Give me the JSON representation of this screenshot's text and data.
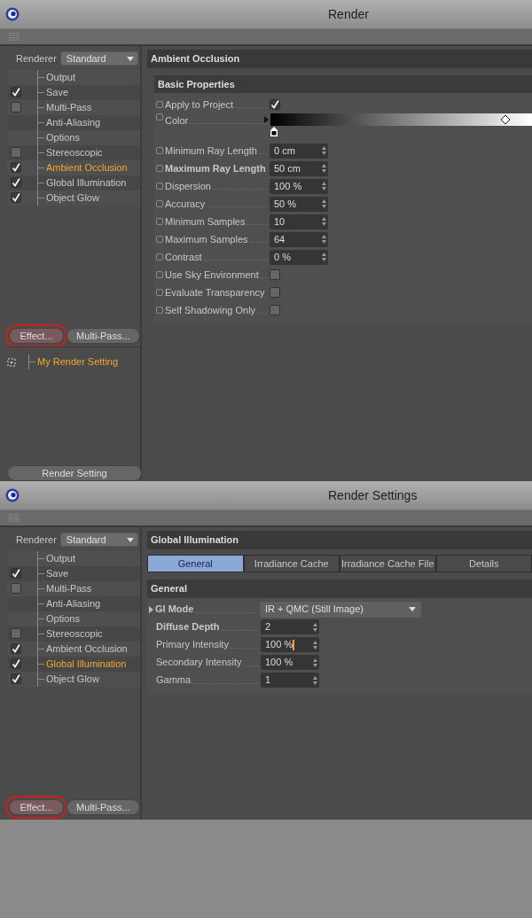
{
  "windows": [
    {
      "title": "Render",
      "renderer": {
        "label": "Renderer",
        "value": "Standard"
      },
      "sidebar": [
        {
          "label": "Output",
          "kind": "plain",
          "selected": false
        },
        {
          "label": "Save",
          "kind": "toggle",
          "checked": true,
          "selected": false
        },
        {
          "label": "Multi-Pass",
          "kind": "toggle",
          "checked": false,
          "selected": false
        },
        {
          "label": "Anti-Aliasing",
          "kind": "plain",
          "selected": false
        },
        {
          "label": "Options",
          "kind": "plain",
          "selected": false
        },
        {
          "label": "Stereoscopic",
          "kind": "toggle",
          "checked": false,
          "selected": false
        },
        {
          "label": "Ambient Occlusion",
          "kind": "toggle",
          "checked": true,
          "selected": true
        },
        {
          "label": "Global Illumination",
          "kind": "toggle",
          "checked": true,
          "selected": false
        },
        {
          "label": "Object Glow",
          "kind": "toggle",
          "checked": true,
          "selected": false
        }
      ],
      "buttons": [
        {
          "label": "Effect...",
          "highlighted": true
        },
        {
          "label": "Multi-Pass...",
          "highlighted": false
        }
      ],
      "settings_tree": [
        {
          "label": "My Render Setting",
          "selected": true
        }
      ],
      "bottom_button": "Render Setting",
      "panel": {
        "title": "Ambient Occlusion",
        "group": "Basic Properties",
        "field_markers": true,
        "fields": [
          {
            "label": "Apply to Project",
            "kind": "checkbox",
            "checked": true
          },
          {
            "label": "Color",
            "kind": "gradient",
            "expanded": false
          },
          {
            "label": "Minimum Ray Length",
            "kind": "number",
            "value": "0 cm"
          },
          {
            "label": "Maximum Ray Length",
            "kind": "number",
            "value": "50 cm",
            "bold": true
          },
          {
            "label": "Dispersion",
            "kind": "number",
            "value": "100 %"
          },
          {
            "label": "Accuracy",
            "kind": "number",
            "value": "50 %"
          },
          {
            "label": "Minimum Samples",
            "kind": "number",
            "value": "10"
          },
          {
            "label": "Maximum Samples",
            "kind": "number",
            "value": "64"
          },
          {
            "label": "Contrast",
            "kind": "number",
            "value": "0 %"
          },
          {
            "label": "Use Sky Environment",
            "kind": "checkbox",
            "checked": false
          },
          {
            "label": "Evaluate Transparency",
            "kind": "checkbox",
            "checked": false
          },
          {
            "label": "Self Shadowing Only",
            "kind": "checkbox",
            "checked": false
          }
        ]
      }
    },
    {
      "title": "Render Settings",
      "renderer": {
        "label": "Renderer",
        "value": "Standard"
      },
      "sidebar": [
        {
          "label": "Output",
          "kind": "plain",
          "selected": false
        },
        {
          "label": "Save",
          "kind": "toggle",
          "checked": true,
          "selected": false
        },
        {
          "label": "Multi-Pass",
          "kind": "toggle",
          "checked": false,
          "selected": false
        },
        {
          "label": "Anti-Aliasing",
          "kind": "plain",
          "selected": false
        },
        {
          "label": "Options",
          "kind": "plain",
          "selected": false
        },
        {
          "label": "Stereoscopic",
          "kind": "toggle",
          "checked": false,
          "selected": false
        },
        {
          "label": "Ambient Occlusion",
          "kind": "toggle",
          "checked": true,
          "selected": false
        },
        {
          "label": "Global Illumination",
          "kind": "toggle",
          "checked": true,
          "selected": true
        },
        {
          "label": "Object Glow",
          "kind": "toggle",
          "checked": true,
          "selected": false
        }
      ],
      "buttons": [
        {
          "label": "Effect...",
          "highlighted": true
        },
        {
          "label": "Multi-Pass...",
          "highlighted": false
        }
      ],
      "panel": {
        "title": "Global Illumination",
        "tabs": [
          {
            "label": "General",
            "selected": true
          },
          {
            "label": "Irradiance Cache",
            "selected": false
          },
          {
            "label": "Irradiance Cache File",
            "selected": false
          },
          {
            "label": "Details",
            "selected": false
          }
        ],
        "group": "General",
        "field_markers": false,
        "fields": [
          {
            "label": "GI Mode",
            "kind": "dropdown",
            "value": "IR + QMC (Still Image)",
            "bold": true,
            "expanded": false
          },
          {
            "label": "Diffuse Depth",
            "kind": "number",
            "value": "2",
            "bold": true
          },
          {
            "label": "Primary Intensity",
            "kind": "number",
            "value": "100 %",
            "focused": true
          },
          {
            "label": "Secondary Intensity",
            "kind": "number",
            "value": "100 %"
          },
          {
            "label": "Gamma",
            "kind": "number",
            "value": "1"
          }
        ]
      }
    }
  ]
}
